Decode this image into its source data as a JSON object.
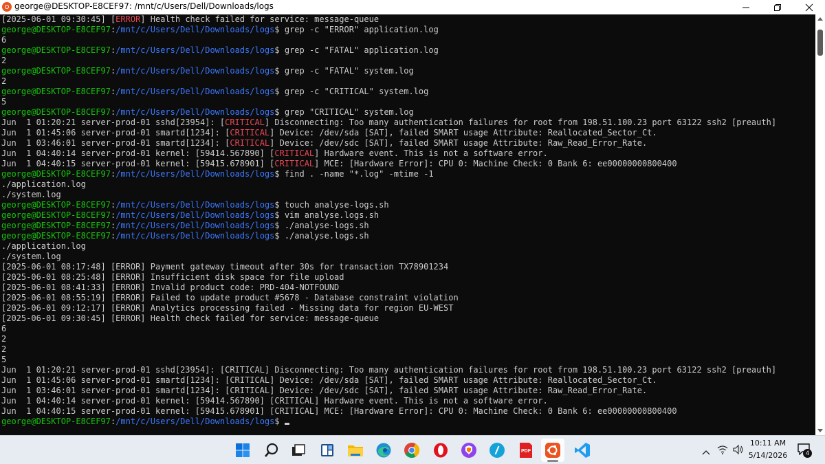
{
  "window": {
    "title": "george@DESKTOP-E8CEF97: /mnt/c/Users/Dell/Downloads/logs"
  },
  "prompt": {
    "user": "george@DESKTOP-E8CEF97",
    "path": "/mnt/c/Users/Dell/Downloads/logs"
  },
  "terminal_lines": [
    [
      {
        "t": "[2025-06-01 09:30:45] ["
      },
      {
        "t": "ERROR",
        "c": "red"
      },
      {
        "t": "] Health check failed for service: message-queue"
      }
    ],
    [
      {
        "t": "george@DESKTOP-E8CEF97",
        "c": "user"
      },
      {
        "t": ":"
      },
      {
        "t": "/mnt/c/Users/Dell/Downloads/logs",
        "c": "path"
      },
      {
        "t": "$ grep -c \"ERROR\" application.log"
      }
    ],
    [
      {
        "t": "6"
      }
    ],
    [
      {
        "t": "george@DESKTOP-E8CEF97",
        "c": "user"
      },
      {
        "t": ":"
      },
      {
        "t": "/mnt/c/Users/Dell/Downloads/logs",
        "c": "path"
      },
      {
        "t": "$ grep -c \"FATAL\" application.log"
      }
    ],
    [
      {
        "t": "2"
      }
    ],
    [
      {
        "t": "george@DESKTOP-E8CEF97",
        "c": "user"
      },
      {
        "t": ":"
      },
      {
        "t": "/mnt/c/Users/Dell/Downloads/logs",
        "c": "path"
      },
      {
        "t": "$ grep -c \"FATAL\" system.log"
      }
    ],
    [
      {
        "t": "2"
      }
    ],
    [
      {
        "t": "george@DESKTOP-E8CEF97",
        "c": "user"
      },
      {
        "t": ":"
      },
      {
        "t": "/mnt/c/Users/Dell/Downloads/logs",
        "c": "path"
      },
      {
        "t": "$ grep -c \"CRITICAL\" system.log"
      }
    ],
    [
      {
        "t": "5"
      }
    ],
    [
      {
        "t": "george@DESKTOP-E8CEF97",
        "c": "user"
      },
      {
        "t": ":"
      },
      {
        "t": "/mnt/c/Users/Dell/Downloads/logs",
        "c": "path"
      },
      {
        "t": "$ grep \"CRITICAL\" system.log"
      }
    ],
    [
      {
        "t": "Jun  1 01:20:21 server-prod-01 sshd[23954]: ["
      },
      {
        "t": "CRITICAL",
        "c": "red"
      },
      {
        "t": "] Disconnecting: Too many authentication failures for root from 198.51.100.23 port 63122 ssh2 [preauth]"
      }
    ],
    [
      {
        "t": "Jun  1 01:45:06 server-prod-01 smartd[1234]: ["
      },
      {
        "t": "CRITICAL",
        "c": "red"
      },
      {
        "t": "] Device: /dev/sda [SAT], failed SMART usage Attribute: Reallocated_Sector_Ct."
      }
    ],
    [
      {
        "t": "Jun  1 03:46:01 server-prod-01 smartd[1234]: ["
      },
      {
        "t": "CRITICAL",
        "c": "red"
      },
      {
        "t": "] Device: /dev/sdc [SAT], failed SMART usage Attribute: Raw_Read_Error_Rate."
      }
    ],
    [
      {
        "t": "Jun  1 04:40:14 server-prod-01 kernel: [59414.567890] ["
      },
      {
        "t": "CRITICAL",
        "c": "red"
      },
      {
        "t": "] Hardware event. This is not a software error."
      }
    ],
    [
      {
        "t": "Jun  1 04:40:15 server-prod-01 kernel: [59415.678901] ["
      },
      {
        "t": "CRITICAL",
        "c": "red"
      },
      {
        "t": "] MCE: [Hardware Error]: CPU 0: Machine Check: 0 Bank 6: ee00000000800400"
      }
    ],
    [
      {
        "t": "george@DESKTOP-E8CEF97",
        "c": "user"
      },
      {
        "t": ":"
      },
      {
        "t": "/mnt/c/Users/Dell/Downloads/logs",
        "c": "path"
      },
      {
        "t": "$ find . -name \"*.log\" -mtime -1"
      }
    ],
    [
      {
        "t": "./application.log"
      }
    ],
    [
      {
        "t": "./system.log"
      }
    ],
    [
      {
        "t": "george@DESKTOP-E8CEF97",
        "c": "user"
      },
      {
        "t": ":"
      },
      {
        "t": "/mnt/c/Users/Dell/Downloads/logs",
        "c": "path"
      },
      {
        "t": "$ touch analyse-logs.sh"
      }
    ],
    [
      {
        "t": "george@DESKTOP-E8CEF97",
        "c": "user"
      },
      {
        "t": ":"
      },
      {
        "t": "/mnt/c/Users/Dell/Downloads/logs",
        "c": "path"
      },
      {
        "t": "$ vim analyse.logs.sh"
      }
    ],
    [
      {
        "t": "george@DESKTOP-E8CEF97",
        "c": "user"
      },
      {
        "t": ":"
      },
      {
        "t": "/mnt/c/Users/Dell/Downloads/logs",
        "c": "path"
      },
      {
        "t": "$ ./analyse-logs.sh"
      }
    ],
    [
      {
        "t": "george@DESKTOP-E8CEF97",
        "c": "user"
      },
      {
        "t": ":"
      },
      {
        "t": "/mnt/c/Users/Dell/Downloads/logs",
        "c": "path"
      },
      {
        "t": "$ ./analyse.logs.sh"
      }
    ],
    [
      {
        "t": "./application.log"
      }
    ],
    [
      {
        "t": "./system.log"
      }
    ],
    [
      {
        "t": "[2025-06-01 08:17:48] [ERROR] Payment gateway timeout after 30s for transaction TX78901234"
      }
    ],
    [
      {
        "t": "[2025-06-01 08:25:48] [ERROR] Insufficient disk space for file upload"
      }
    ],
    [
      {
        "t": "[2025-06-01 08:41:33] [ERROR] Invalid product code: PRD-404-NOTFOUND"
      }
    ],
    [
      {
        "t": "[2025-06-01 08:55:19] [ERROR] Failed to update product #5678 - Database constraint violation"
      }
    ],
    [
      {
        "t": "[2025-06-01 09:12:17] [ERROR] Analytics processing failed - Missing data for region EU-WEST"
      }
    ],
    [
      {
        "t": "[2025-06-01 09:30:45] [ERROR] Health check failed for service: message-queue"
      }
    ],
    [
      {
        "t": "6"
      }
    ],
    [
      {
        "t": "2"
      }
    ],
    [
      {
        "t": "2"
      }
    ],
    [
      {
        "t": "5"
      }
    ],
    [
      {
        "t": "Jun  1 01:20:21 server-prod-01 sshd[23954]: [CRITICAL] Disconnecting: Too many authentication failures for root from 198.51.100.23 port 63122 ssh2 [preauth]"
      }
    ],
    [
      {
        "t": "Jun  1 01:45:06 server-prod-01 smartd[1234]: [CRITICAL] Device: /dev/sda [SAT], failed SMART usage Attribute: Reallocated_Sector_Ct."
      }
    ],
    [
      {
        "t": "Jun  1 03:46:01 server-prod-01 smartd[1234]: [CRITICAL] Device: /dev/sdc [SAT], failed SMART usage Attribute: Raw_Read_Error_Rate."
      }
    ],
    [
      {
        "t": "Jun  1 04:40:14 server-prod-01 kernel: [59414.567890] [CRITICAL] Hardware event. This is not a software error."
      }
    ],
    [
      {
        "t": "Jun  1 04:40:15 server-prod-01 kernel: [59415.678901] [CRITICAL] MCE: [Hardware Error]: CPU 0: Machine Check: 0 Bank 6: ee00000000800400"
      }
    ],
    [
      {
        "t": "george@DESKTOP-E8CEF97",
        "c": "user"
      },
      {
        "t": ":"
      },
      {
        "t": "/mnt/c/Users/Dell/Downloads/logs",
        "c": "path"
      },
      {
        "t": "$ "
      }
    ]
  ],
  "colors": {
    "terminal_bg": "#0c0c0c",
    "text": "#cccccc",
    "user": "#16c60c",
    "path": "#3b78ff",
    "red": "#e74856"
  },
  "taskbar": {
    "icons": [
      {
        "name": "windows-start-icon"
      },
      {
        "name": "search-icon"
      },
      {
        "name": "task-view-icon"
      },
      {
        "name": "widgets-icon"
      },
      {
        "name": "file-explorer-icon"
      },
      {
        "name": "edge-icon"
      },
      {
        "name": "chrome-icon"
      },
      {
        "name": "opera-icon"
      },
      {
        "name": "brave-icon"
      },
      {
        "name": "slash-app-icon"
      },
      {
        "name": "pdf-app-icon"
      },
      {
        "name": "ubuntu-icon",
        "active": true
      },
      {
        "name": "vscode-icon"
      }
    ],
    "pdf_label": "PDF",
    "clock_time": "10:11 AM",
    "clock_date": "5/14/2026",
    "notification_count": "4"
  }
}
